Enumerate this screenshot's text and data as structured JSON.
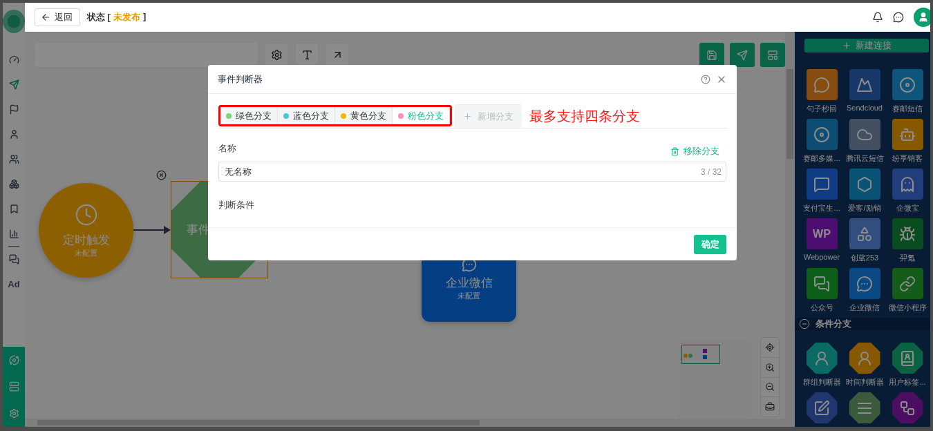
{
  "sidebar": {
    "items": [
      {
        "selected": false
      },
      {
        "selected": true
      },
      {
        "selected": false
      },
      {
        "selected": false
      },
      {
        "selected": false
      },
      {
        "selected": false
      },
      {
        "selected": false
      },
      {
        "selected": false
      },
      {
        "selected": false
      },
      {
        "label": "Ad",
        "selected": false
      }
    ]
  },
  "topbar": {
    "back": "返回",
    "status_label": "状态 [",
    "status_value": "未发布",
    "status_suffix": "]"
  },
  "canvas": {
    "nodes": [
      {
        "kind": "circle",
        "title": "定时触发",
        "subtitle": "未配置"
      },
      {
        "kind": "octagon",
        "title": "事件",
        "selected": true
      },
      {
        "kind": "card",
        "title": "企业微信",
        "subtitle": "未配置"
      }
    ]
  },
  "panel": {
    "new_button": "新建连接",
    "apps": [
      {
        "label": "句子秒回"
      },
      {
        "label": "Sendcloud"
      },
      {
        "label": "赛邮短信"
      },
      {
        "label": "赛邮多媒..."
      },
      {
        "label": "腾讯云短信"
      },
      {
        "label": "纷享销客"
      },
      {
        "label": "支付宝生..."
      },
      {
        "label": "爱客/励销"
      },
      {
        "label": "企微宝"
      },
      {
        "label": "Webpower",
        "mark": "WP"
      },
      {
        "label": "创蓝253"
      },
      {
        "label": "羿氪"
      },
      {
        "label": "公众号"
      },
      {
        "label": "企业微信"
      },
      {
        "label": "微信小程序"
      }
    ],
    "section": {
      "title": "条件分支",
      "expanded": true
    },
    "conditions": [
      {
        "label": "群组判断器"
      },
      {
        "label": "时间判断器"
      },
      {
        "label": "用户标签..."
      }
    ]
  },
  "dialog": {
    "title": "事件判断器",
    "tabs": [
      {
        "label": "绿色分支",
        "color": "#7ad87a",
        "selected": false
      },
      {
        "label": "蓝色分支",
        "color": "#4cc4e0",
        "selected": false
      },
      {
        "label": "黄色分支",
        "color": "#f7b500",
        "selected": false
      },
      {
        "label": "粉色分支",
        "color": "#ff8fbd",
        "selected": true
      }
    ],
    "add_tab": {
      "label": "新增分支",
      "disabled": true
    },
    "annotation": "最多支持四条分支",
    "name_label": "名称",
    "remove_link": "移除分支",
    "name_field": {
      "value": "无名称",
      "counter": "3 / 32"
    },
    "condition_label": "判断条件",
    "confirm": "确定"
  }
}
